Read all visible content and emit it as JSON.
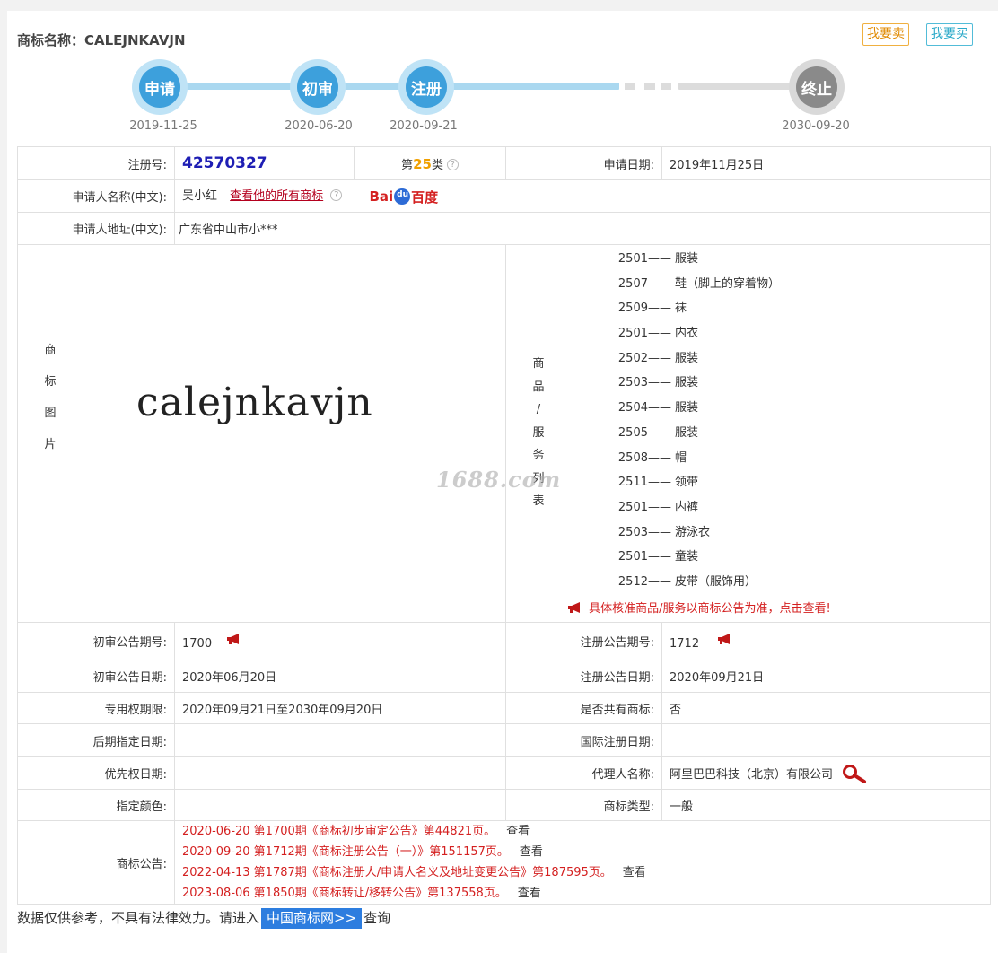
{
  "header": {
    "title": "商标名称：CALEJNKAVJN",
    "sell_label": "我要卖",
    "buy_label": "我要买"
  },
  "timeline": [
    {
      "label": "申请",
      "date": "2019-11-25"
    },
    {
      "label": "初审",
      "date": "2020-06-20"
    },
    {
      "label": "注册",
      "date": "2020-09-21"
    },
    {
      "label": "终止",
      "date": "2030-09-20"
    }
  ],
  "info": {
    "reg_no_label": "注册号:",
    "reg_no": "42570327",
    "class_prefix": "第",
    "class_num": "25",
    "class_suffix": "类",
    "apply_date_label": "申请日期:",
    "apply_date": "2019年11月25日",
    "applicant_label": "申请人名称(中文):",
    "applicant": "吴小红",
    "view_all_link": "查看他的所有商标",
    "baidu_left": "Bai",
    "baidu_right": "百度",
    "address_label": "申请人地址(中文):",
    "address": "广东省中山市小***",
    "image_label_chars": [
      "商",
      "标",
      "图",
      "片"
    ],
    "trademark_image_text": "calejnkavjn",
    "goods_label_chars": [
      "商",
      "品",
      "/",
      "服",
      "务",
      "列",
      "表"
    ],
    "goods": [
      {
        "code": "2501",
        "name": "服装"
      },
      {
        "code": "2507",
        "name": "鞋（脚上的穿着物）"
      },
      {
        "code": "2509",
        "name": "袜"
      },
      {
        "code": "2501",
        "name": "内衣"
      },
      {
        "code": "2502",
        "name": "服装"
      },
      {
        "code": "2503",
        "name": "服装"
      },
      {
        "code": "2504",
        "name": "服装"
      },
      {
        "code": "2505",
        "name": "服装"
      },
      {
        "code": "2508",
        "name": "帽"
      },
      {
        "code": "2511",
        "name": "领带"
      },
      {
        "code": "2501",
        "name": "内裤"
      },
      {
        "code": "2503",
        "name": "游泳衣"
      },
      {
        "code": "2501",
        "name": "童装"
      },
      {
        "code": "2512",
        "name": "皮带（服饰用）"
      }
    ],
    "goods_dash": "——",
    "goods_notice": "具体核准商品/服务以商标公告为准，点击查看!",
    "prelim_no_label": "初审公告期号:",
    "prelim_no": "1700",
    "reg_pub_no_label": "注册公告期号:",
    "reg_pub_no": "1712",
    "prelim_date_label": "初审公告日期:",
    "prelim_date": "2020年06月20日",
    "reg_pub_date_label": "注册公告日期:",
    "reg_pub_date": "2020年09月21日",
    "term_label": "专用权期限:",
    "term": "2020年09月21日至2030年09月20日",
    "shared_label": "是否共有商标:",
    "shared": "否",
    "later_designation_label": "后期指定日期:",
    "intl_reg_date_label": "国际注册日期:",
    "priority_label": "优先权日期:",
    "agent_label": "代理人名称:",
    "agent": "阿里巴巴科技（北京）有限公司",
    "color_label": "指定颜色:",
    "type_label": "商标类型:",
    "type": "一般",
    "announce_label": "商标公告:",
    "announcements": [
      {
        "text": "2020-06-20 第1700期《商标初步审定公告》第44821页。",
        "view": "查看"
      },
      {
        "text": "2020-09-20 第1712期《商标注册公告（一）》第151157页。",
        "view": "查看"
      },
      {
        "text": "2022-04-13 第1787期《商标注册人/申请人名义及地址变更公告》第187595页。",
        "view": "查看"
      },
      {
        "text": "2023-08-06 第1850期《商标转让/移转公告》第137558页。",
        "view": "查看"
      }
    ]
  },
  "footer": {
    "prefix": "数据仅供参考，不具有法律效力。请进入",
    "link": "中国商标网>>",
    "suffix": "查询"
  },
  "watermark": "1688.com",
  "colors": {
    "accent_blue": "#3da0dc",
    "terminated_grey": "#8a8a8a",
    "red": "#d42020"
  }
}
